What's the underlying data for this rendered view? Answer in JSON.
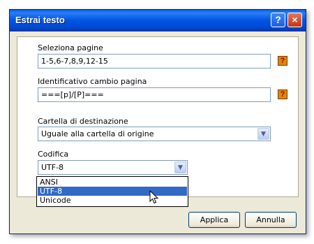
{
  "window": {
    "title": "Estrai testo"
  },
  "titlebar": {
    "help_glyph": "?",
    "close_glyph": "×"
  },
  "pages": {
    "label": "Seleziona pagine",
    "value": "1-5,6-7,8,9,12-15",
    "help_icon": "question-icon"
  },
  "pagebreak": {
    "label": "Identificativo cambio pagina",
    "value": "===[p]/[P]===",
    "help_icon": "question-icon"
  },
  "destination": {
    "label": "Cartella di destinazione",
    "selected": "Uguale alla cartella di origine"
  },
  "encoding": {
    "label": "Codifica",
    "selected": "UTF-8",
    "options": [
      "ANSI",
      "UTF-8",
      "Unicode"
    ],
    "highlighted_index": 1
  },
  "buttons": {
    "apply": "Applica",
    "cancel": "Annulla"
  },
  "colors": {
    "titlebar": "#0055e5",
    "selection": "#316ac5",
    "dialog_bg": "#ece9d8"
  }
}
